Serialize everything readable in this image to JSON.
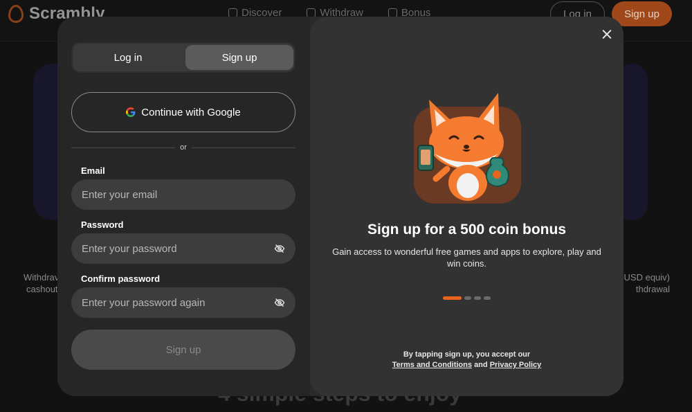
{
  "background": {
    "brand": "Scrambly",
    "nav": [
      {
        "label": "Discover",
        "icon": "gamepad-icon"
      },
      {
        "label": "Withdraw",
        "icon": "wallet-icon"
      },
      {
        "label": "Bonus",
        "icon": "gift-icon"
      }
    ],
    "login_label": "Log in",
    "signup_label": "Sign up",
    "left_side_text": [
      "Withdrav",
      "cashout"
    ],
    "right_side_text": [
      "USD equiv)",
      "thdrawal"
    ],
    "bottom_text": "4 simple steps to enjoy"
  },
  "modal": {
    "tabs": [
      {
        "label": "Log in",
        "active": false
      },
      {
        "label": "Sign up",
        "active": true
      }
    ],
    "google_label": "Continue with Google",
    "divider": "or",
    "fields": {
      "email": {
        "label": "Email",
        "placeholder": "Enter your email",
        "value": ""
      },
      "password": {
        "label": "Password",
        "placeholder": "Enter your password",
        "value": ""
      },
      "confirm": {
        "label": "Confirm password",
        "placeholder": "Enter your password again",
        "value": ""
      }
    },
    "submit_label": "Sign up",
    "promo": {
      "title": "Sign up for a 500 coin bonus",
      "subtitle": "Gain access to wonderful free games and apps to explore, play and win coins.",
      "carousel_total": 4,
      "carousel_active": 1
    },
    "legal": {
      "line1": "By tapping sign up, you accept our",
      "terms": "Terms and Conditions",
      "and": "and",
      "privacy": "Privacy Policy"
    }
  },
  "colors": {
    "accent": "#e8651f",
    "modal_bg": "#2a2a2a",
    "field_bg": "#3d3d3d"
  }
}
